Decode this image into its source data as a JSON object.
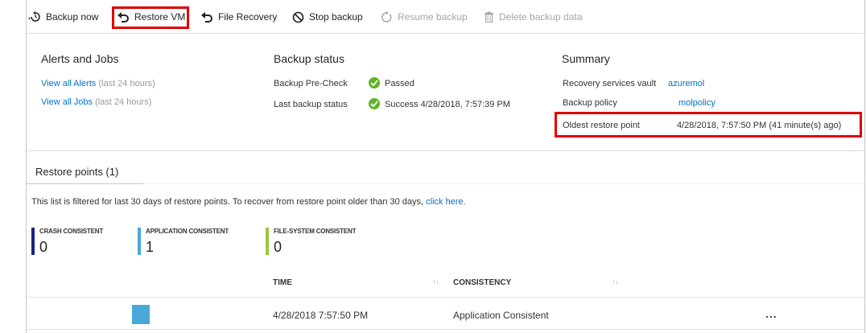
{
  "toolbar": {
    "backup_now": "Backup now",
    "restore_vm": "Restore VM",
    "file_recovery": "File Recovery",
    "stop_backup": "Stop backup",
    "resume_backup": "Resume backup",
    "delete_backup_data": "Delete backup data"
  },
  "alerts": {
    "title": "Alerts and Jobs",
    "alerts_link": "View all Alerts",
    "alerts_note": "(last 24 hours)",
    "jobs_link": "View all Jobs",
    "jobs_note": "(last 24 hours)"
  },
  "backup_status": {
    "title": "Backup status",
    "precheck_label": "Backup Pre-Check",
    "precheck_value": "Passed",
    "last_label": "Last backup status",
    "last_value": "Success 4/28/2018, 7:57:39 PM"
  },
  "summary": {
    "title": "Summary",
    "vault_label": "Recovery services vault",
    "vault_value": "azuremol",
    "policy_label": "Backup policy",
    "policy_value": "molpolicy",
    "oldest_label": "Oldest restore point",
    "oldest_value": "4/28/2018, 7:57:50 PM (41 minute(s) ago)"
  },
  "restore_points": {
    "tab_label": "Restore points (1)",
    "filter_text": "This list is filtered for last 30 days of restore points. To recover from restore point older than 30 days,",
    "filter_link": "click here.",
    "counters": [
      {
        "label": "CRASH CONSISTENT",
        "value": "0",
        "color": "#1a237e"
      },
      {
        "label": "APPLICATION CONSISTENT",
        "value": "1",
        "color": "#48a9d8"
      },
      {
        "label": "FILE-SYSTEM CONSISTENT",
        "value": "0",
        "color": "#9bc53d"
      }
    ],
    "columns": {
      "time": "TIME",
      "consistency": "CONSISTENCY"
    },
    "rows": [
      {
        "time": "4/28/2018 7:57:50 PM",
        "consistency": "Application Consistent",
        "more": "..."
      }
    ]
  }
}
